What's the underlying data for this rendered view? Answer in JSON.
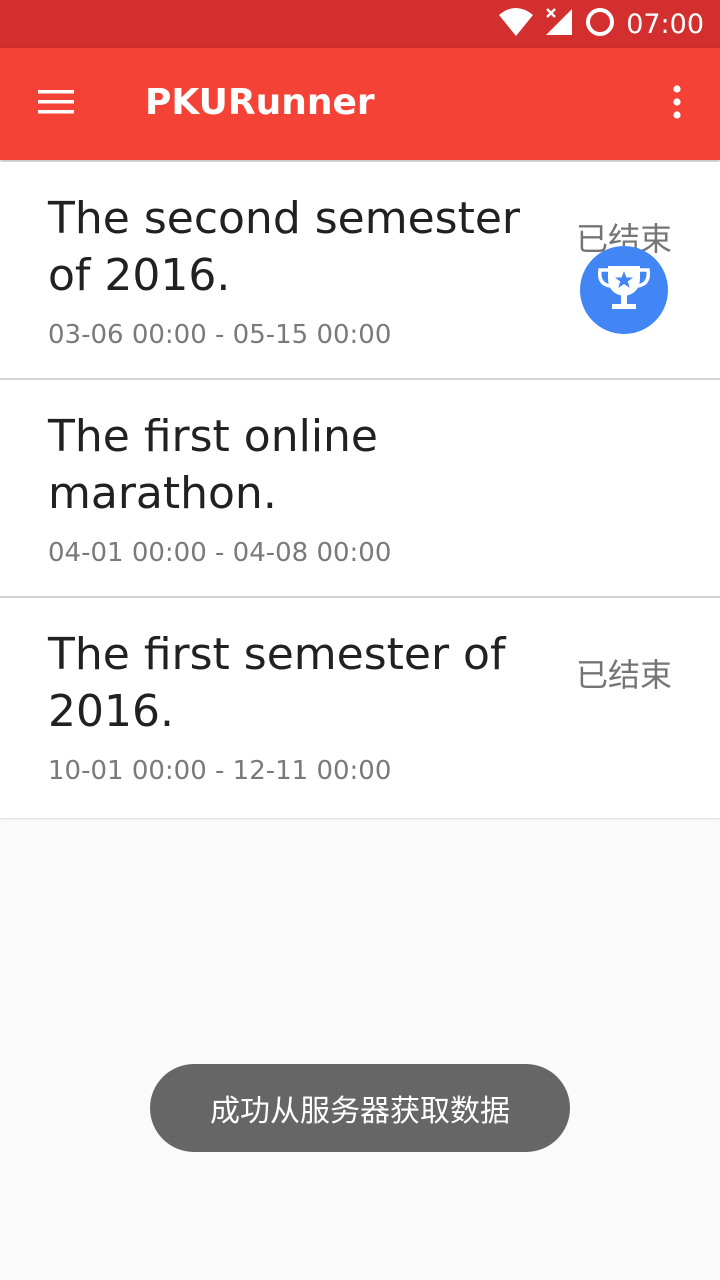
{
  "status_bar": {
    "time": "07:00",
    "icons": [
      "wifi-icon",
      "signal-no-data-icon",
      "sync-icon"
    ]
  },
  "app_bar": {
    "title": "PKURunner",
    "menu_icon": "hamburger-menu-icon",
    "overflow_icon": "more-vert-icon"
  },
  "events": [
    {
      "title": "The second semester of 2016.",
      "time_range": "03-06 00:00 - 05-15 00:00",
      "status": "已结束"
    },
    {
      "title": "The first online marathon.",
      "time_range": "04-01 00:00 - 04-08 00:00",
      "status_icon": "trophy-icon"
    },
    {
      "title": "The first semester of 2016.",
      "time_range": "10-01 00:00 - 12-11 00:00",
      "status": "已结束"
    }
  ],
  "colors": {
    "status_bar": "#d32f2f",
    "app_bar": "#f44336",
    "trophy_badge": "#4285f4"
  },
  "toast": {
    "message": "成功从服务器获取数据"
  }
}
